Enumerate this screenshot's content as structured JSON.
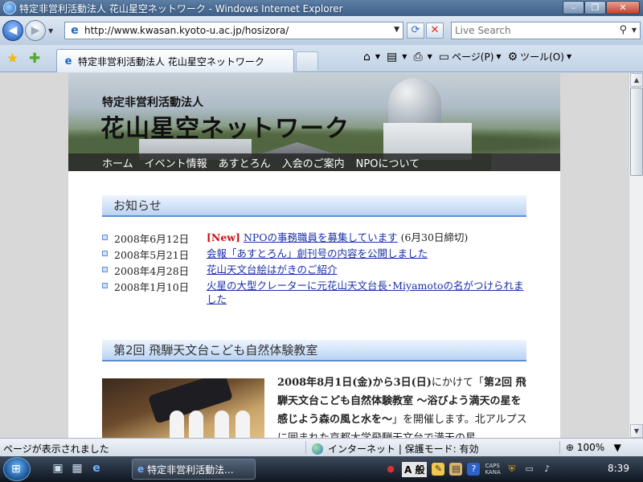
{
  "window": {
    "title": "特定非営利活動法人 花山星空ネットワーク - Windows Internet Explorer",
    "minimize": "–",
    "maximize": "❐",
    "close": "✕"
  },
  "addressbar": {
    "url": "http://www.kwasan.kyoto-u.ac.jp/hosizora/",
    "search_placeholder": "Live Search"
  },
  "tab": {
    "label": "特定非営利活動法人 花山星空ネットワーク"
  },
  "commandbar": {
    "home": "⌂",
    "feeds": "▤",
    "print": "⎙",
    "page_label": "ページ(P)",
    "tools_label": "ツール(O)"
  },
  "site": {
    "org_sub": "特定非営利活動法人",
    "org_name": "花山星空ネットワーク",
    "nav": [
      "ホーム",
      "イベント情報",
      "あすとろん",
      "入会のご案内",
      "NPOについて"
    ]
  },
  "news": {
    "heading": "お知らせ",
    "items": [
      {
        "date": "2008年6月12日",
        "badge": "[New]",
        "link": "NPOの事務職員を募集しています",
        "note": " (6月30日締切)"
      },
      {
        "date": "2008年5月21日",
        "badge": "",
        "link": "会報「あすとろん」創刊号の内容を公開しました",
        "note": ""
      },
      {
        "date": "2008年4月28日",
        "badge": "",
        "link": "花山天文台絵はがきのご紹介",
        "note": ""
      },
      {
        "date": "2008年1月10日",
        "badge": "",
        "link": "火星の大型クレーターに元花山天文台長･Miyamotoの名がつけられました",
        "note": ""
      }
    ]
  },
  "event": {
    "heading": "第2回 飛騨天文台こども自然体験教室",
    "date_bold": "2008年8月1日(金)から3日(日)",
    "text1": "にかけて「",
    "title_bold": "第2回 飛騨天文台こども自然体験教室 ～浴びよう満天の星を 感じよう森の風と水を～",
    "text2": "」を開催します。北アルプスに囲まれた京都大学飛騨天文台で満天の星"
  },
  "statusbar": {
    "left": "ページが表示されました",
    "zone": "インターネット | 保護モード: 有効",
    "zoom": "100%"
  },
  "taskbar": {
    "task_label": "特定非営利活動法...",
    "ime": "A 般",
    "caps": "CAPS",
    "kana": "KANA",
    "time": "8:39"
  }
}
